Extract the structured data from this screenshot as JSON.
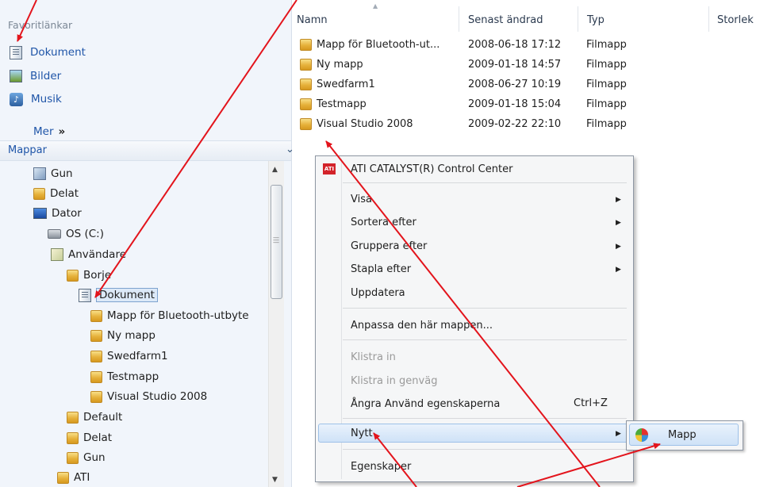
{
  "favorites": {
    "header": "Favoritlänkar",
    "items": [
      {
        "label": "Dokument",
        "icon": "documents-icon"
      },
      {
        "label": "Bilder",
        "icon": "pictures-icon"
      },
      {
        "label": "Musik",
        "icon": "music-icon"
      }
    ],
    "more_label": "Mer",
    "more_chevron": "»"
  },
  "folders_pane": {
    "header": "Mappar",
    "chevron": "⌄"
  },
  "tree": [
    {
      "label": "Gun",
      "icon": "user-folder-icon"
    },
    {
      "label": "Delat",
      "icon": "folder-icon"
    },
    {
      "label": "Dator",
      "icon": "computer-icon"
    },
    {
      "label": "OS (C:)",
      "icon": "drive-icon"
    },
    {
      "label": "Användare",
      "icon": "users-folder-icon"
    },
    {
      "label": "Borje",
      "icon": "folder-icon"
    },
    {
      "label": "Dokument",
      "icon": "documents-icon",
      "selected": true
    },
    {
      "label": "Mapp för Bluetooth-utbyte",
      "icon": "folder-icon"
    },
    {
      "label": "Ny mapp",
      "icon": "folder-icon"
    },
    {
      "label": "Swedfarm1",
      "icon": "folder-icon"
    },
    {
      "label": "Testmapp",
      "icon": "folder-icon"
    },
    {
      "label": "Visual Studio 2008",
      "icon": "folder-icon"
    },
    {
      "label": "Default",
      "icon": "folder-icon"
    },
    {
      "label": "Delat",
      "icon": "folder-icon"
    },
    {
      "label": "Gun",
      "icon": "folder-icon"
    },
    {
      "label": "ATI",
      "icon": "folder-icon"
    }
  ],
  "columns": {
    "name": "Namn",
    "modified": "Senast ändrad",
    "type": "Typ",
    "size": "Storlek"
  },
  "files": [
    {
      "name": "Mapp för Bluetooth-ut...",
      "modified": "2008-06-18 17:12",
      "type": "Filmapp"
    },
    {
      "name": "Ny mapp",
      "modified": "2009-01-18 14:57",
      "type": "Filmapp"
    },
    {
      "name": "Swedfarm1",
      "modified": "2008-06-27 10:19",
      "type": "Filmapp"
    },
    {
      "name": "Testmapp",
      "modified": "2009-01-18 15:04",
      "type": "Filmapp"
    },
    {
      "name": "Visual Studio 2008",
      "modified": "2009-02-22 22:10",
      "type": "Filmapp"
    }
  ],
  "context_menu": {
    "ati": "ATI CATALYST(R) Control Center",
    "ati_icon_text": "ATI",
    "visa": "Visa",
    "sortera": "Sortera efter",
    "gruppera": "Gruppera efter",
    "stapla": "Stapla efter",
    "uppdatera": "Uppdatera",
    "anpassa": "Anpassa den här mappen...",
    "klistra": "Klistra in",
    "klistra_genvag": "Klistra in genväg",
    "angra": "Ångra Använd egenskaperna",
    "angra_shortcut": "Ctrl+Z",
    "nytt": "Nytt",
    "egenskaper": "Egenskaper",
    "submenu_arrow": "▶"
  },
  "submenu": {
    "mapp": "Mapp"
  },
  "colors": {
    "annotation_arrow": "#e3141c",
    "link_blue": "#1f55a8",
    "menu_highlight": "#cfe2f7"
  }
}
